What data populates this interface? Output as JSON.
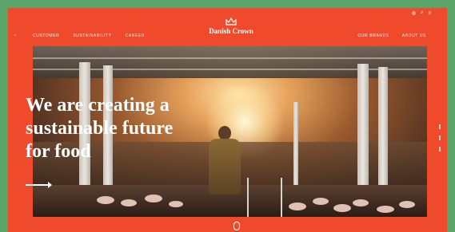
{
  "header": {
    "nav_left": [
      "Customer",
      "Sustainability",
      "Career"
    ],
    "nav_right": [
      "Our brands",
      "About us"
    ],
    "logo_text": "Danish Crown",
    "utility_icons": [
      "globe-icon",
      "search-icon",
      "menu-icon"
    ]
  },
  "hero": {
    "headline_lines": [
      "We are creating a",
      "sustainable future",
      "for food"
    ],
    "image_icon": "pig-farm-photo"
  },
  "colors": {
    "background": "#5aa469",
    "brand_orange": "#f04a2c",
    "text": "#ffffff"
  }
}
